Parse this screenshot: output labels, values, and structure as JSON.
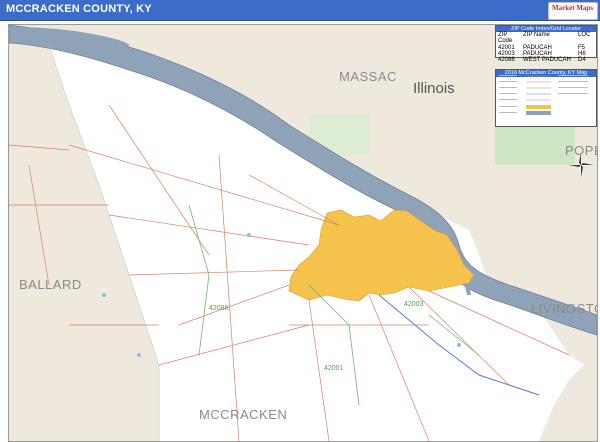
{
  "header": {
    "title": "MCCRACKEN COUNTY, KY",
    "logo_line1": "Market Maps",
    "logo_line2": ""
  },
  "map": {
    "labels": {
      "massac": "MASSAC",
      "illinois": "Illinois",
      "pope": "POPE",
      "ballard": "BALLARD",
      "livingston": "LIVINGSTON",
      "mccracken": "MCCRACKEN",
      "zip1": "42086",
      "zip2": "42001",
      "zip3": "42001",
      "zip4": "42003",
      "zip5": "42003"
    },
    "colors": {
      "water": "#8fa3b8",
      "county": "#ffffff",
      "outside": "#efe8dc",
      "city": "#f5c24c",
      "roads": "#d3826a",
      "state_park": "#cfe6c4"
    }
  },
  "zip_legend": {
    "title": "ZIP Code Index/Grid Locator",
    "headers": {
      "zip": "ZIP Code",
      "name": "ZIP Name",
      "loc": "LOC"
    },
    "rows": [
      {
        "zip": "42001",
        "name": "PADUCAH",
        "loc": "F5"
      },
      {
        "zip": "42003",
        "name": "PADUCAH",
        "loc": "H6"
      },
      {
        "zip": "42086",
        "name": "WEST PADUCAH",
        "loc": "D4"
      }
    ]
  },
  "map_legend": {
    "title": "2016 McCracken County, KY Map"
  },
  "compass": {
    "icon": "compass-rose-icon"
  }
}
